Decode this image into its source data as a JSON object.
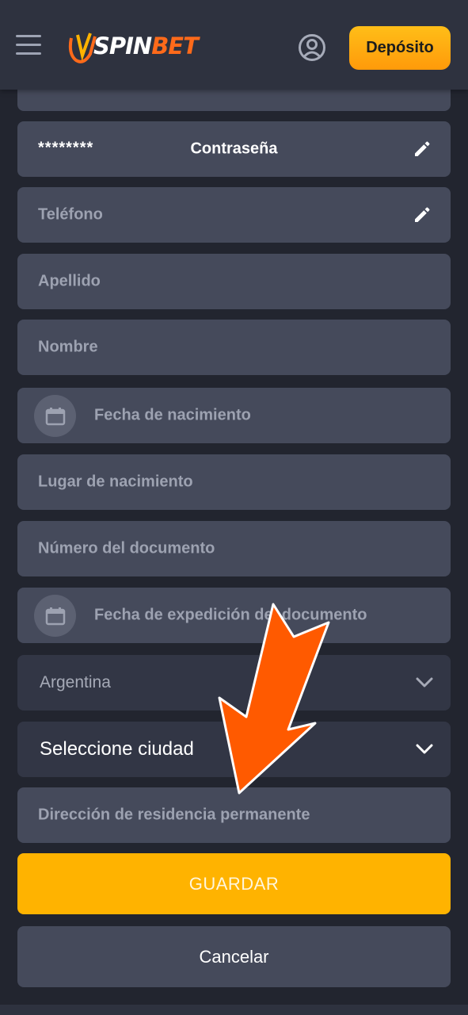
{
  "header": {
    "logo_prefix": "JV",
    "logo_spin": "SPIN",
    "logo_bet": "BET",
    "deposit_label": "Depósito"
  },
  "form": {
    "password_value": "********",
    "password_label": "Contraseña",
    "phone_placeholder": "Teléfono",
    "surname_placeholder": "Apellido",
    "name_placeholder": "Nombre",
    "birth_date_placeholder": "Fecha de nacimiento",
    "birth_place_placeholder": "Lugar de nacimiento",
    "document_number_placeholder": "Número del documento",
    "document_issue_date_placeholder": "Fecha de expedición del documento",
    "country_value": "Argentina",
    "city_value": "Seleccione ciudad",
    "address_placeholder": "Dirección de residencia permanente"
  },
  "actions": {
    "save_label": "GUARDAR",
    "cancel_label": "Cancelar"
  },
  "colors": {
    "accent": "#ffb300",
    "annotation_arrow": "#ff5a00"
  },
  "icons": {
    "menu": "hamburger-menu-icon",
    "user": "user-circle-icon",
    "edit": "pencil-icon",
    "calendar": "calendar-icon",
    "dropdown": "chevron-down-icon"
  }
}
